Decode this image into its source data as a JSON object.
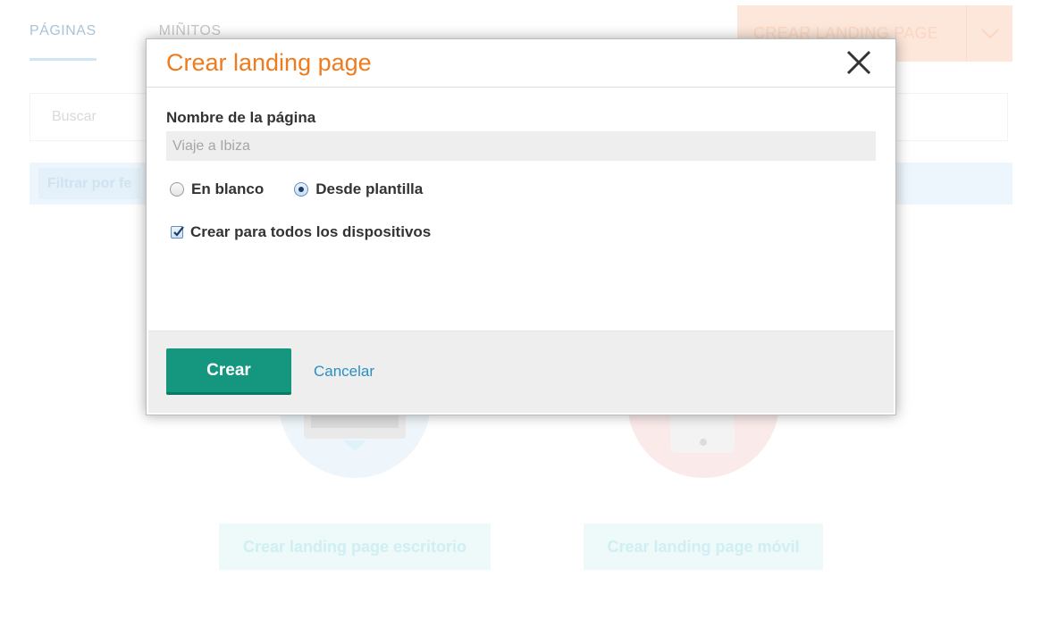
{
  "background": {
    "tabs": [
      {
        "label": "PÁGINAS"
      },
      {
        "label": "MIÑITOS"
      }
    ],
    "create_button_label": "CREAR LANDING PAGE",
    "search_placeholder": "Buscar",
    "filter_label": "Filtrar por fe",
    "desktop_button_label": "Crear landing page escritorio",
    "mobile_button_label": "Crear landing page móvil"
  },
  "modal": {
    "title": "Crear landing page",
    "name_label": "Nombre de la página",
    "name_placeholder": "Viaje a Ibiza",
    "name_value": "",
    "radio_options": [
      {
        "label": "En blanco",
        "checked": false
      },
      {
        "label": "Desde plantilla",
        "checked": true
      }
    ],
    "all_devices_label": "Crear para todos los dispositivos",
    "all_devices_checked": true,
    "create_label": "Crear",
    "cancel_label": "Cancelar"
  },
  "colors": {
    "title_orange": "#ef7b1f",
    "primary_green": "#15967f",
    "link_blue": "#2a8fc5"
  },
  "icons": {
    "close": "close-icon",
    "chevron": "chevron-down-icon",
    "checkmark": "checkmark-icon"
  }
}
